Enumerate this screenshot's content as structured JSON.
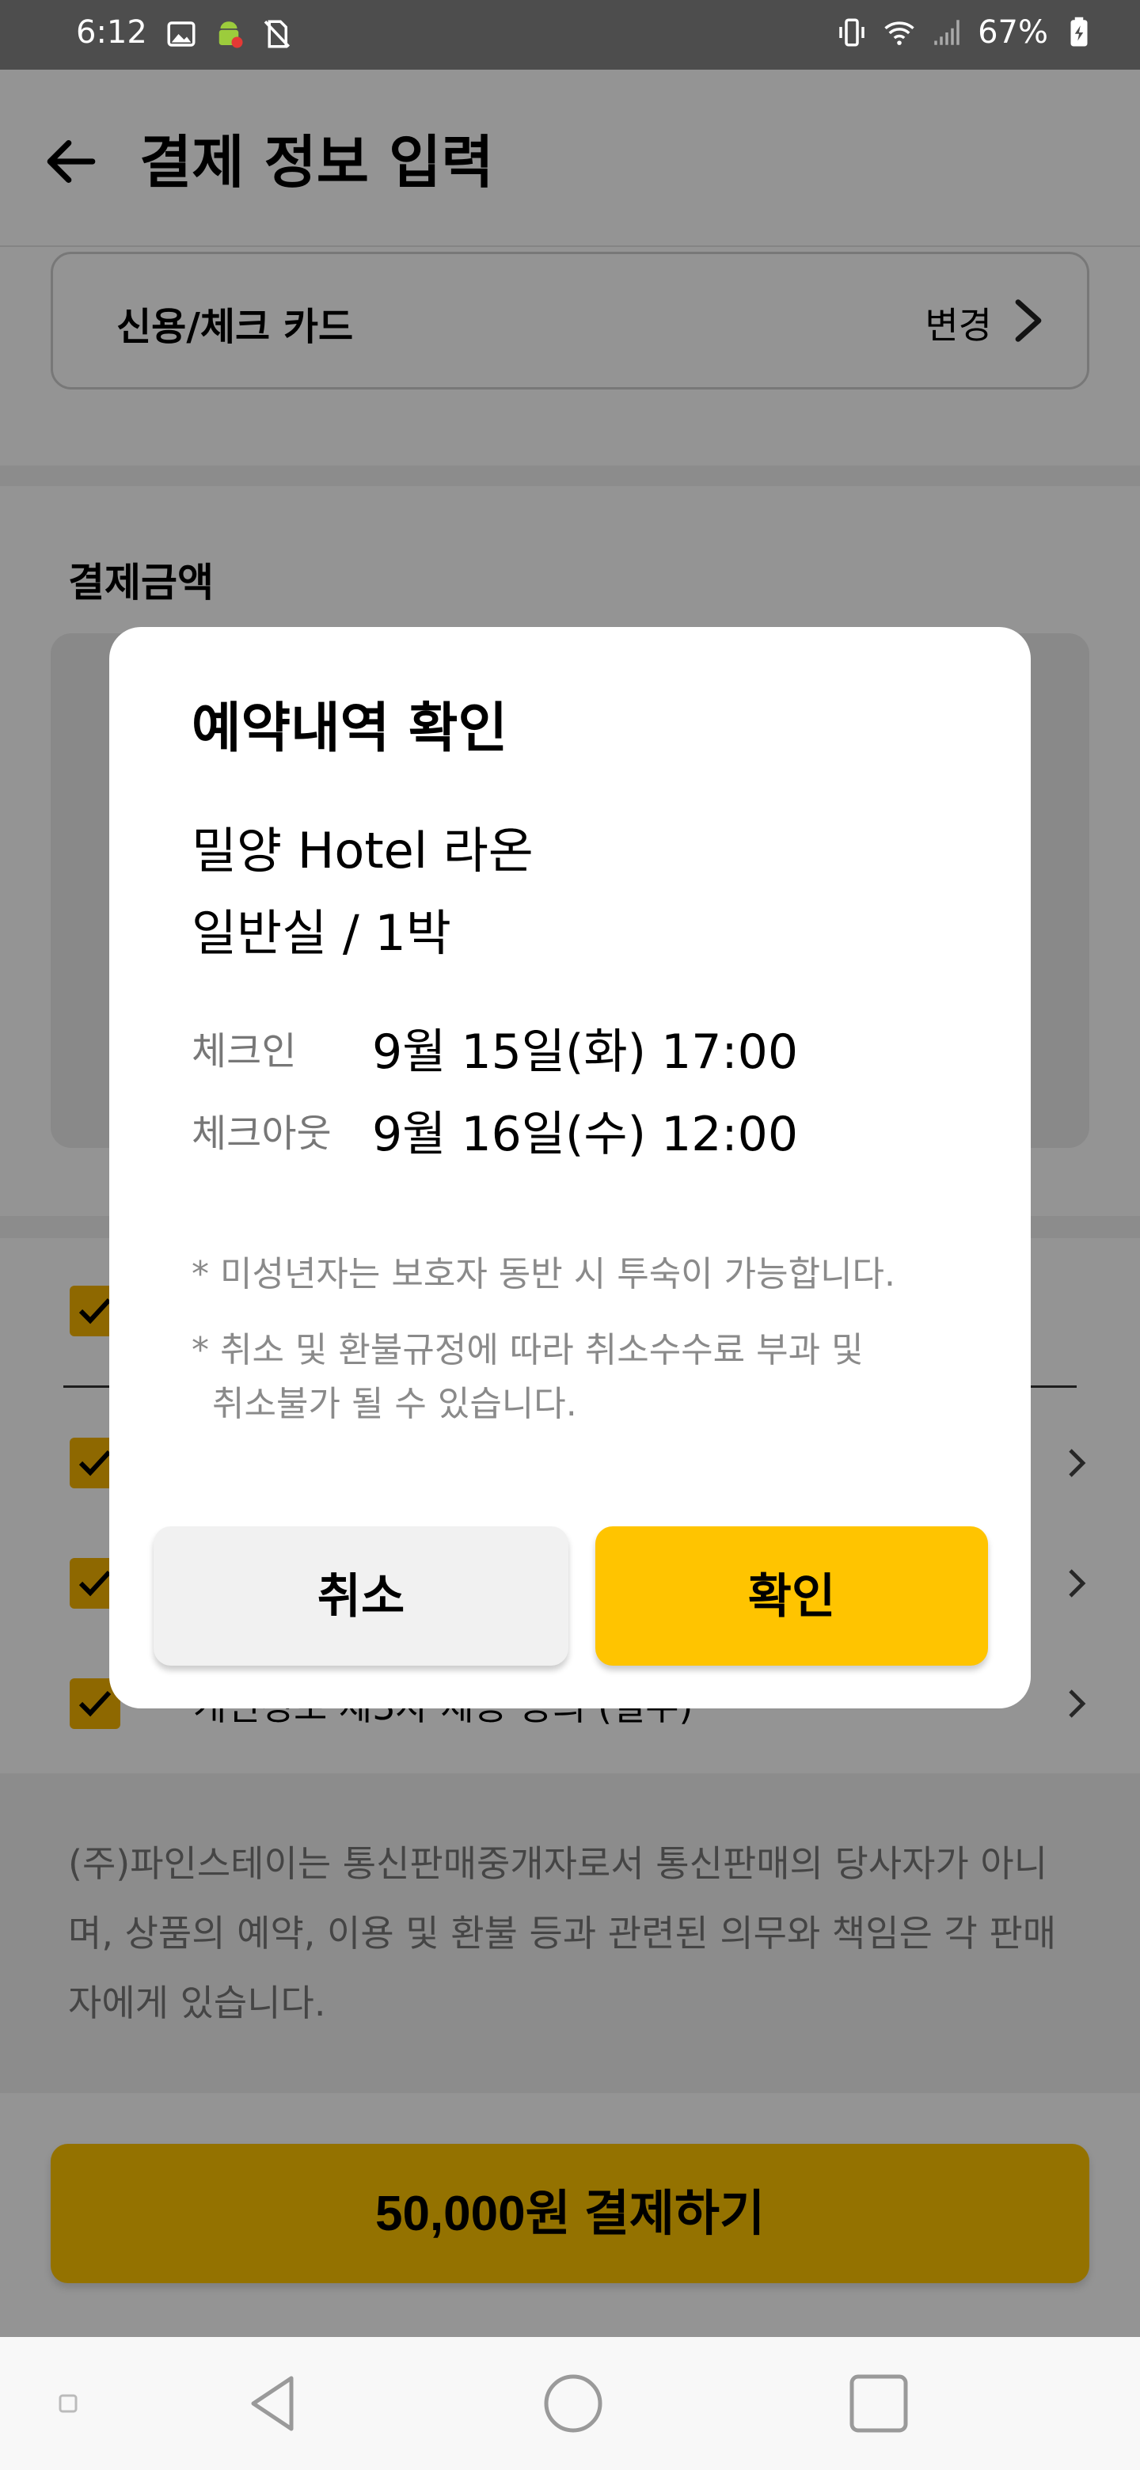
{
  "status_bar": {
    "time": "6:12",
    "battery": "67%",
    "left_icons": [
      "image-icon",
      "android-debug-icon",
      "no-sim-icon"
    ],
    "right_icons": [
      "vibrate-icon",
      "wifi-icon",
      "signal-icon",
      "battery-charging-icon"
    ]
  },
  "header": {
    "title": "결제 정보 입력",
    "back_icon": "back-arrow-icon"
  },
  "payment_method": {
    "label": "신용/체크 카드",
    "change": "변경"
  },
  "amount_section": {
    "title": "결제금액"
  },
  "agreements": {
    "last_partial_label": "개인정보 제3자 제공 동의 (필수)"
  },
  "disclaimer": "(주)파인스테이는 통신판매중개자로서 통신판매의 당사자가 아니며, 상품의 예약, 이용 및 환불 등과 관련된 의무와 책임은 각 판매자에게 있습니다.",
  "pay_button": "50,000원 결제하기",
  "dialog": {
    "title": "예약내역 확인",
    "hotel": "밀양 Hotel 라온",
    "room": "일반실 / 1박",
    "checkin_label": "체크인",
    "checkin_value": "9월 15일(화) 17:00",
    "checkout_label": "체크아웃",
    "checkout_value": "9월 16일(수) 12:00",
    "note1": "* 미성년자는 보호자 동반 시 투숙이 가능합니다.",
    "note2": "* 취소 및 환불규정에 따라 취소수수료 부과 및",
    "note2_cont": "취소불가 될 수 있습니다.",
    "cancel": "취소",
    "confirm": "확인"
  },
  "colors": {
    "accent": "#ffc400",
    "dim_overlay": "rgba(0,0,0,0.42)"
  }
}
